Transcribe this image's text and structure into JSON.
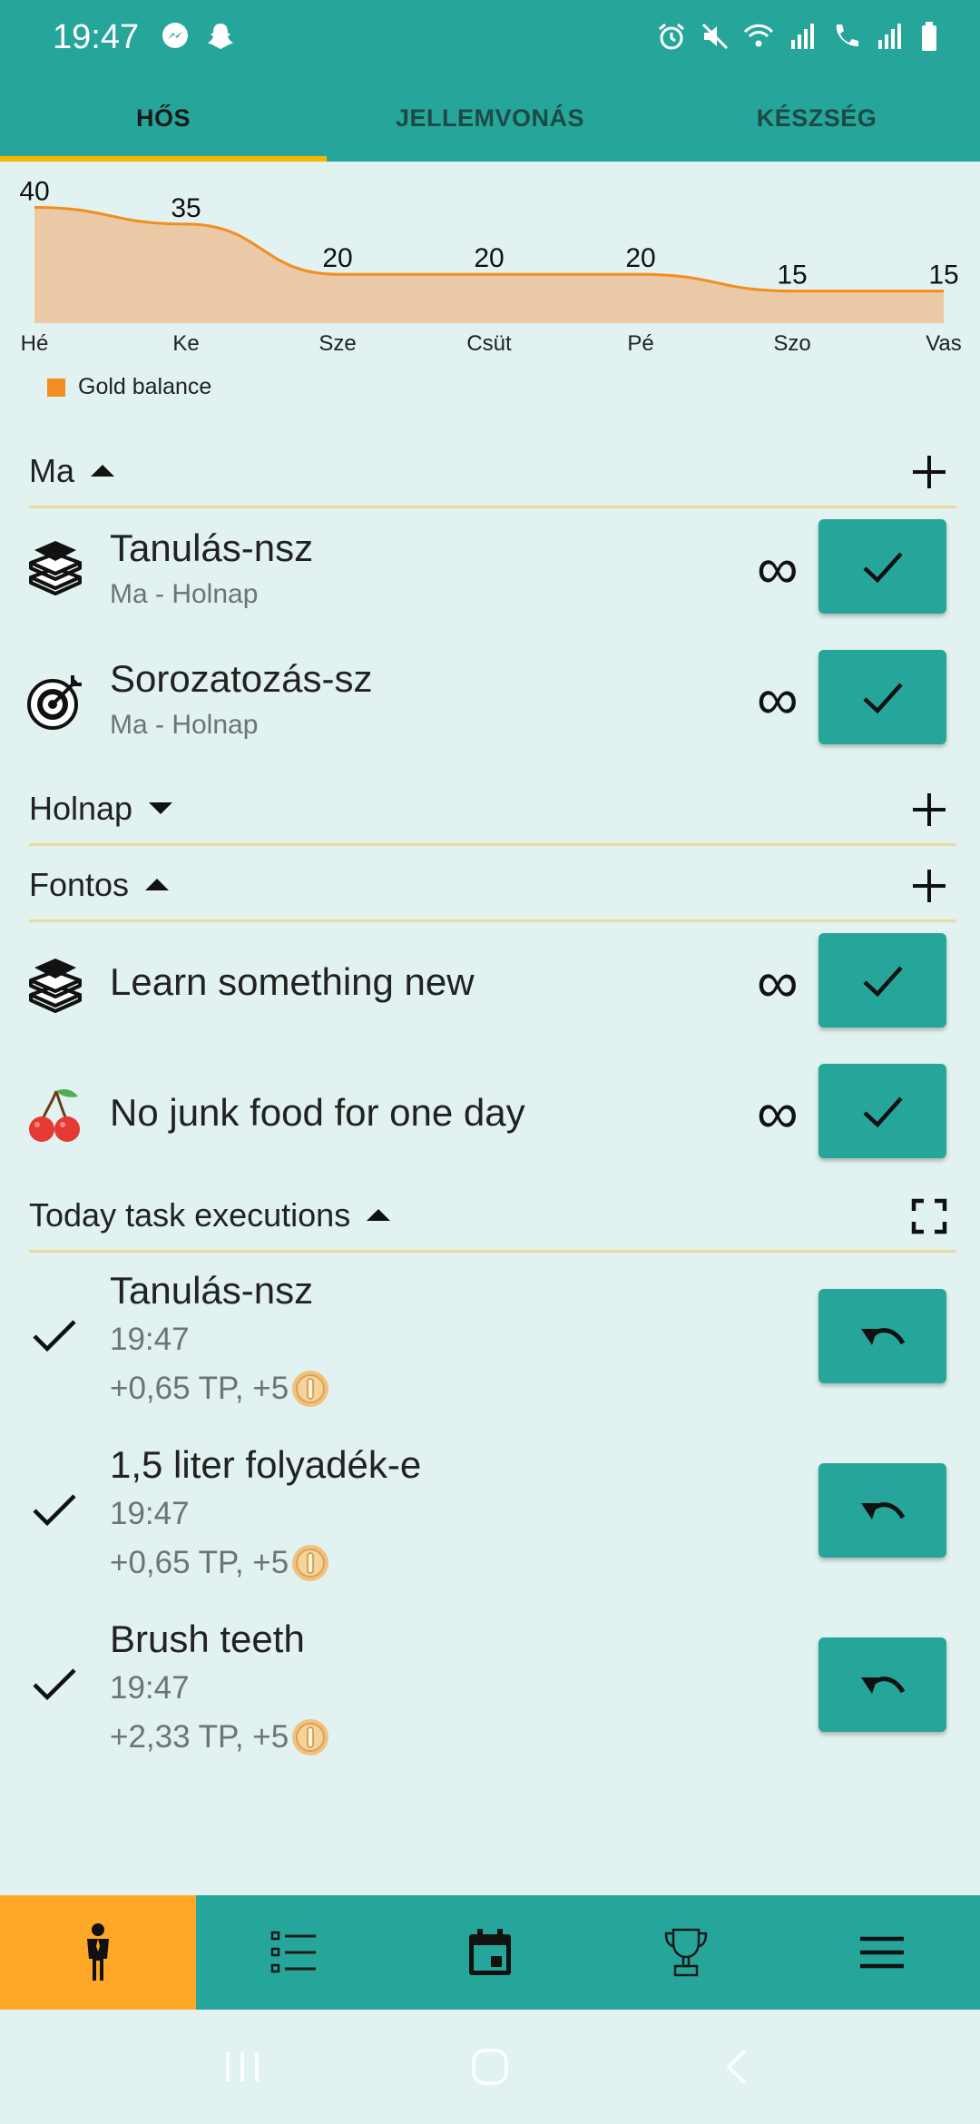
{
  "status_bar": {
    "time": "19:47",
    "left_icons": [
      "messenger-icon",
      "snapchat-icon"
    ],
    "right_icons": [
      "alarm-icon",
      "mute-icon",
      "wifi-icon",
      "signal-icon",
      "call-sim2-icon",
      "signal-icon",
      "battery-icon"
    ]
  },
  "tabs": [
    {
      "label": "HŐS",
      "active": true
    },
    {
      "label": "JELLEMVONÁS",
      "active": false
    },
    {
      "label": "KÉSZSÉG",
      "active": false
    }
  ],
  "chart_data": {
    "type": "area",
    "categories": [
      "Hé",
      "Ke",
      "Sze",
      "Csüt",
      "Pé",
      "Szo",
      "Vas"
    ],
    "series": [
      {
        "name": "Gold balance",
        "values": [
          40,
          35,
          20,
          20,
          20,
          15,
          15
        ]
      }
    ],
    "ylim": [
      0,
      45
    ],
    "grid": false,
    "legend": "bottom-left",
    "colors": {
      "fill": "#ebc9a6",
      "line": "#f38d1f"
    }
  },
  "sections": {
    "ma": {
      "title": "Ma",
      "expanded": true,
      "action_icon": "plus-icon"
    },
    "holnap": {
      "title": "Holnap",
      "expanded": false,
      "action_icon": "plus-icon"
    },
    "fontos": {
      "title": "Fontos",
      "expanded": true,
      "action_icon": "plus-icon"
    },
    "executions": {
      "title": "Today task executions",
      "expanded": true,
      "action_icon": "fullscreen-icon"
    }
  },
  "ma_tasks": [
    {
      "icon": "books-icon",
      "title": "Tanulás-nsz",
      "subtitle": "Ma - Holnap",
      "repeat": "∞"
    },
    {
      "icon": "target-icon",
      "title": "Sorozatozás-sz",
      "subtitle": "Ma - Holnap",
      "repeat": "∞"
    }
  ],
  "fontos_tasks": [
    {
      "icon": "books-icon",
      "title": "Learn something new",
      "repeat": "∞"
    },
    {
      "icon": "cherry-icon",
      "title": "No junk food for one day",
      "repeat": "∞"
    }
  ],
  "executions": [
    {
      "title": "Tanulás-nsz",
      "time": "19:47",
      "reward": "+0,65 TP, +5"
    },
    {
      "title": "1,5 liter folyadék-e",
      "time": "19:47",
      "reward": "+0,65 TP, +5"
    },
    {
      "title": "Brush teeth",
      "time": "19:47",
      "reward": "+2,33 TP, +5"
    }
  ],
  "bottom_nav": [
    {
      "icon": "hero-icon",
      "active": true
    },
    {
      "icon": "task-list-icon",
      "active": false
    },
    {
      "icon": "calendar-icon",
      "active": false
    },
    {
      "icon": "trophy-icon",
      "active": false
    },
    {
      "icon": "menu-icon",
      "active": false
    }
  ],
  "colors": {
    "primary": "#26a69a",
    "accent": "#ffb300",
    "background": "#e1f2f1",
    "nav_active": "#ffa726"
  }
}
